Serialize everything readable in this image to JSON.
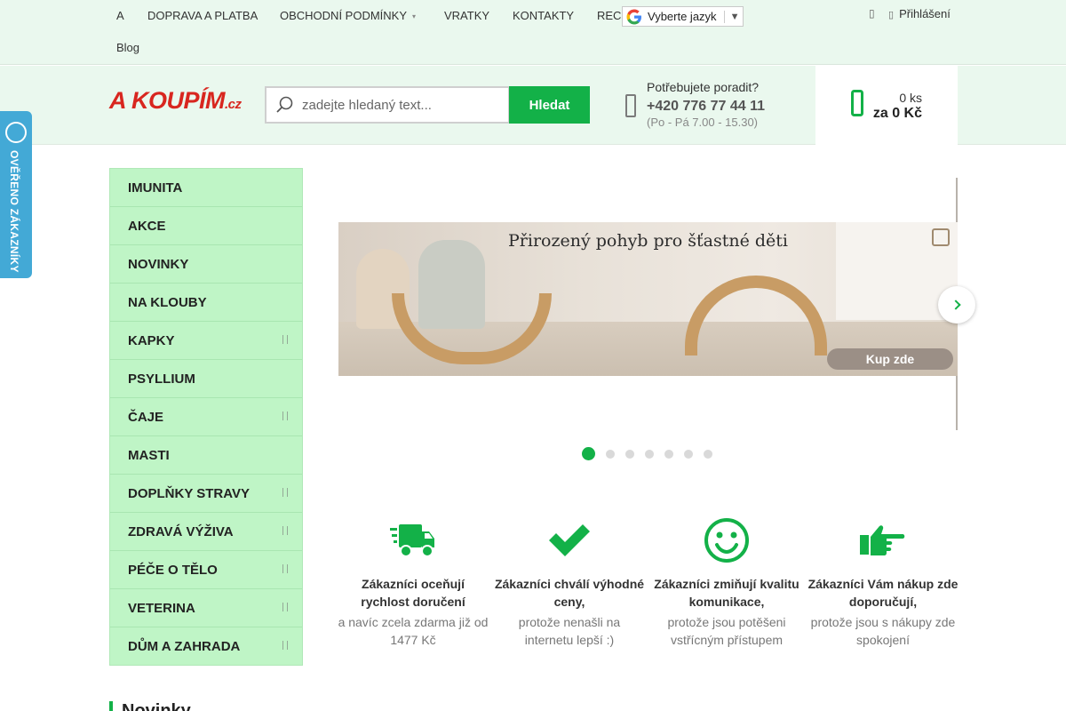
{
  "topnav": {
    "items": [
      {
        "label": "A"
      },
      {
        "label": "DOPRAVA A PLATBA"
      },
      {
        "label": "OBCHODNÍ PODMÍNKY"
      },
      {
        "label": "VRATKY"
      },
      {
        "label": "KONTAKTY"
      },
      {
        "label": "REC"
      }
    ],
    "blog": "Blog",
    "language": "Vyberte jazyk",
    "login": "Přihlášení"
  },
  "header": {
    "logo": "A KOUPÍM",
    "logo_tld": ".cz",
    "search_placeholder": "zadejte hledaný text...",
    "search_button": "Hledat",
    "help_title": "Potřebujete poradit?",
    "help_phone": "+420 776 77 44 11",
    "help_hours": "(Po - Pá 7.00 - 15.30)",
    "cart_count": "0 ks",
    "cart_price": "za 0 Kč"
  },
  "badge": {
    "text": "OVĚŘENO ZÁKAZNÍKY"
  },
  "menu": {
    "items": [
      {
        "label": "IMUNITA",
        "has_sub": false
      },
      {
        "label": "AKCE",
        "has_sub": false
      },
      {
        "label": "NOVINKY",
        "has_sub": false
      },
      {
        "label": "NA KLOUBY",
        "has_sub": false
      },
      {
        "label": "KAPKY",
        "has_sub": true
      },
      {
        "label": "PSYLLIUM",
        "has_sub": false
      },
      {
        "label": "ČAJE",
        "has_sub": true
      },
      {
        "label": "MASTI",
        "has_sub": false
      },
      {
        "label": "DOPLŇKY STRAVY",
        "has_sub": true
      },
      {
        "label": "ZDRAVÁ VÝŽIVA",
        "has_sub": true
      },
      {
        "label": "PÉČE O TĚLO",
        "has_sub": true
      },
      {
        "label": "VETERINA",
        "has_sub": true
      },
      {
        "label": "DŮM A ZAHRADA",
        "has_sub": true
      }
    ]
  },
  "banner": {
    "title": "Přirozený pohyb pro šťastné děti",
    "button": "Kup zde"
  },
  "slider": {
    "dot_count": 7,
    "active": 1
  },
  "features": [
    {
      "icon": "truck-icon",
      "title": "Zákazníci oceňují rychlost doručení",
      "sub": "a navíc zcela zdarma již od 1477 Kč"
    },
    {
      "icon": "checkmark-icon",
      "title": "Zákazníci chválí výhodné ceny,",
      "sub": "protože nenašli na internetu lepší :)"
    },
    {
      "icon": "smiley-icon",
      "title": "Zákazníci zmiňují kvalitu komunikace,",
      "sub": "protože jsou potěšeni vstřícným přístupem"
    },
    {
      "icon": "pointing-hand-icon",
      "title": "Zákazníci Vám nákup zde doporučují,",
      "sub": "protože jsou s nákupy zde spokojení"
    }
  ],
  "section": {
    "title": "Novinky"
  },
  "colors": {
    "accent": "#13b148",
    "menu_bg": "#bff5c6",
    "header_bg": "#eaf8ee",
    "logo": "#d8261f"
  }
}
